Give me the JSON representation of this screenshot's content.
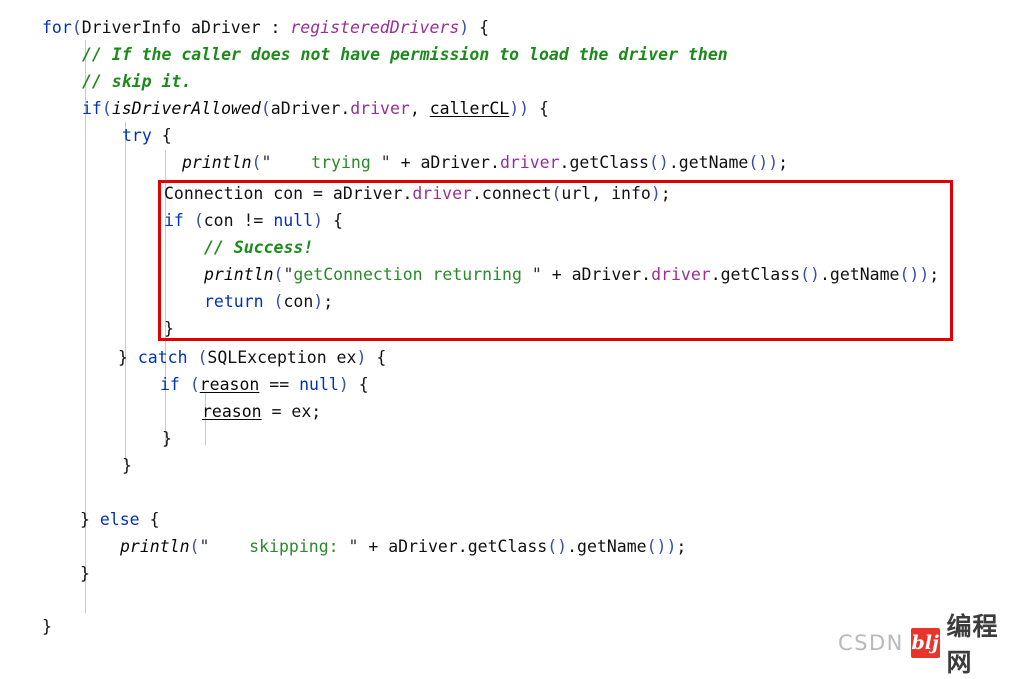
{
  "editor": {
    "language": "Java",
    "background_color": "#ffffff",
    "font_size_px": 16.5,
    "line_height_px": 27,
    "colors": {
      "keyword": "#0033b3",
      "comment": "#1c8b1c",
      "string": "#2a8a2a",
      "field": "#9b2d9b",
      "plain": "#111111",
      "indent_guide": "#c9c9c9",
      "highlight_border": "#e00000"
    }
  },
  "code": {
    "lines": [
      {
        "n": 1,
        "indent": 0,
        "text": "for(DriverInfo aDriver : registeredDrivers) {"
      },
      {
        "n": 2,
        "indent": 1,
        "text": "// If the caller does not have permission to load the driver then"
      },
      {
        "n": 3,
        "indent": 1,
        "text": "// skip it."
      },
      {
        "n": 4,
        "indent": 1,
        "text": "if(isDriverAllowed(aDriver.driver, callerCL)) {"
      },
      {
        "n": 5,
        "indent": 2,
        "text": "try {"
      },
      {
        "n": 6,
        "indent": 3,
        "text": "println(\"    trying \" + aDriver.driver.getClass().getName());"
      },
      {
        "n": 7,
        "indent": 3,
        "text": "Connection con = aDriver.driver.connect(url, info);"
      },
      {
        "n": 8,
        "indent": 3,
        "text": "if (con != null) {"
      },
      {
        "n": 9,
        "indent": 4,
        "text": "// Success!"
      },
      {
        "n": 10,
        "indent": 4,
        "text": "println(\"getConnection returning \" + aDriver.driver.getClass().getName());"
      },
      {
        "n": 11,
        "indent": 4,
        "text": "return (con);"
      },
      {
        "n": 12,
        "indent": 3,
        "text": "}"
      },
      {
        "n": 13,
        "indent": 2,
        "text": "} catch (SQLException ex) {"
      },
      {
        "n": 14,
        "indent": 3,
        "text": "if (reason == null) {"
      },
      {
        "n": 15,
        "indent": 4,
        "text": "reason = ex;"
      },
      {
        "n": 16,
        "indent": 3,
        "text": "}"
      },
      {
        "n": 17,
        "indent": 2,
        "text": "}"
      },
      {
        "n": 18,
        "indent": 0,
        "text": ""
      },
      {
        "n": 19,
        "indent": 1,
        "text": "} else {"
      },
      {
        "n": 20,
        "indent": 2,
        "text": "println(\"    skipping: \" + aDriver.getClass().getName());"
      },
      {
        "n": 21,
        "indent": 1,
        "text": "}"
      },
      {
        "n": 22,
        "indent": 0,
        "text": ""
      },
      {
        "n": 23,
        "indent": 0,
        "text": "}"
      }
    ]
  },
  "annotation": {
    "type": "rectangle",
    "color": "#e00000",
    "covers_lines": "7-12",
    "description": "Red rectangle highlighting the connection attempt and successful return block"
  },
  "watermark": {
    "brand": "CSDN",
    "logo_text": "blj",
    "site_name": "编程网"
  }
}
